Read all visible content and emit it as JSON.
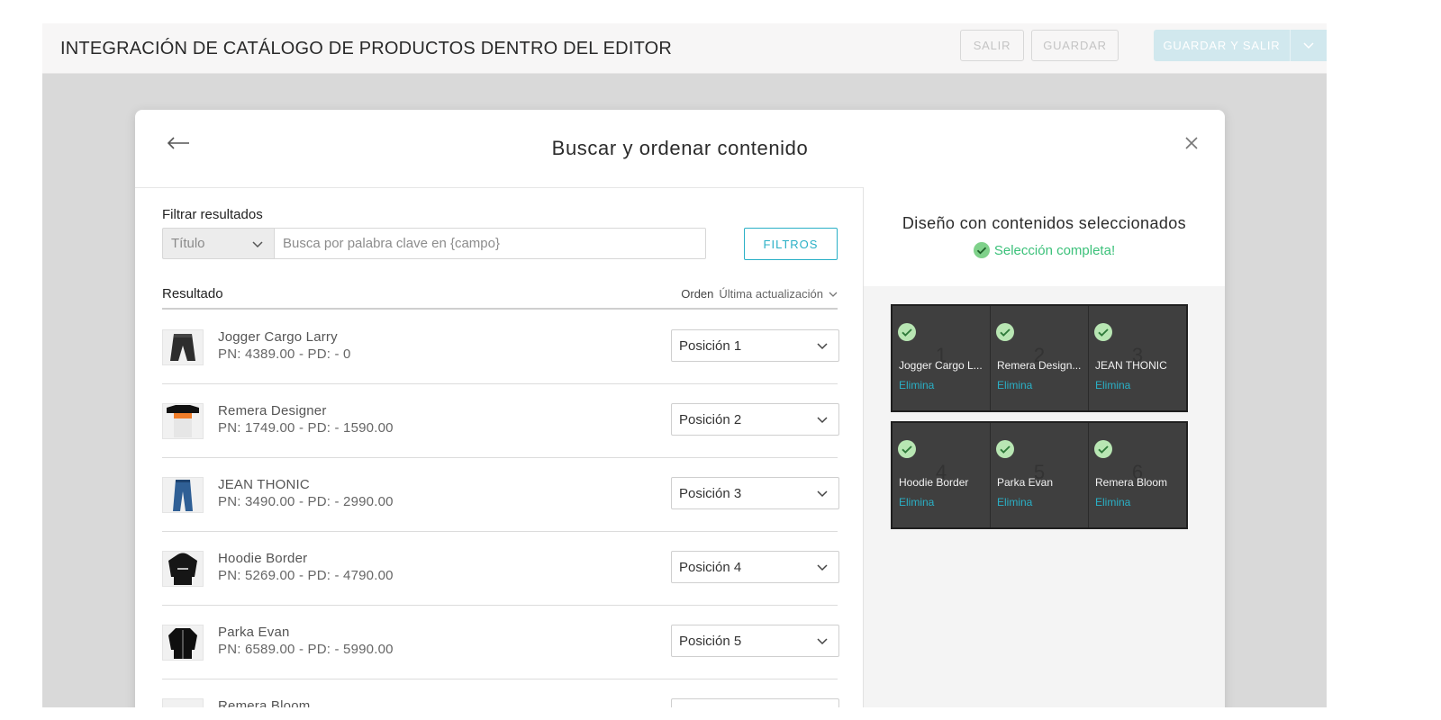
{
  "topbar": {
    "title": "INTEGRACIÓN DE CATÁLOGO DE PRODUCTOS DENTRO DEL EDITOR",
    "buttons": {
      "salir": "SALIR",
      "guardar": "GUARDAR",
      "guardar_y_salir": "GUARDAR Y SALIR"
    }
  },
  "modal": {
    "title": "Buscar y ordenar contenido",
    "filter": {
      "label": "Filtrar resultados",
      "field_value": "Título",
      "placeholder": "Busca por palabra clave en {campo}",
      "filters_button": "FILTROS"
    },
    "results": {
      "label": "Resultado",
      "order_label": "Orden",
      "order_value": "Última actualización",
      "rows": [
        {
          "name": "Jogger Cargo Larry",
          "price": "PN: 4389.00 - PD: - 0",
          "position": "Posición 1",
          "thumb": "pants"
        },
        {
          "name": "Remera Designer",
          "price": "PN: 1749.00 - PD: - 1590.00",
          "position": "Posición 2",
          "thumb": "tshirt"
        },
        {
          "name": "JEAN THONIC",
          "price": "PN: 3490.00 - PD: - 2990.00",
          "position": "Posición 3",
          "thumb": "jeans"
        },
        {
          "name": "Hoodie Border",
          "price": "PN: 5269.00 - PD: - 4790.00",
          "position": "Posición 4",
          "thumb": "hoodie"
        },
        {
          "name": "Parka Evan",
          "price": "PN: 6589.00 - PD: - 5990.00",
          "position": "Posición 5",
          "thumb": "parka"
        },
        {
          "name": "Remera Bloom",
          "price": "",
          "position": "",
          "thumb": "tshirt"
        }
      ]
    },
    "selection": {
      "title": "Diseño con contenidos seleccionados",
      "status": "Selección completa!",
      "remove_label": "Elimina",
      "cells": [
        {
          "num": "1",
          "name": "Jogger Cargo L..."
        },
        {
          "num": "2",
          "name": "Remera Design..."
        },
        {
          "num": "3",
          "name": "JEAN THONIC"
        },
        {
          "num": "4",
          "name": "Hoodie Border"
        },
        {
          "num": "5",
          "name": "Parka Evan"
        },
        {
          "num": "6",
          "name": "Remera Bloom"
        }
      ]
    }
  },
  "colors": {
    "accent": "#2ab0c6",
    "success": "#3cc17a",
    "tile": "#3f3f3f"
  }
}
